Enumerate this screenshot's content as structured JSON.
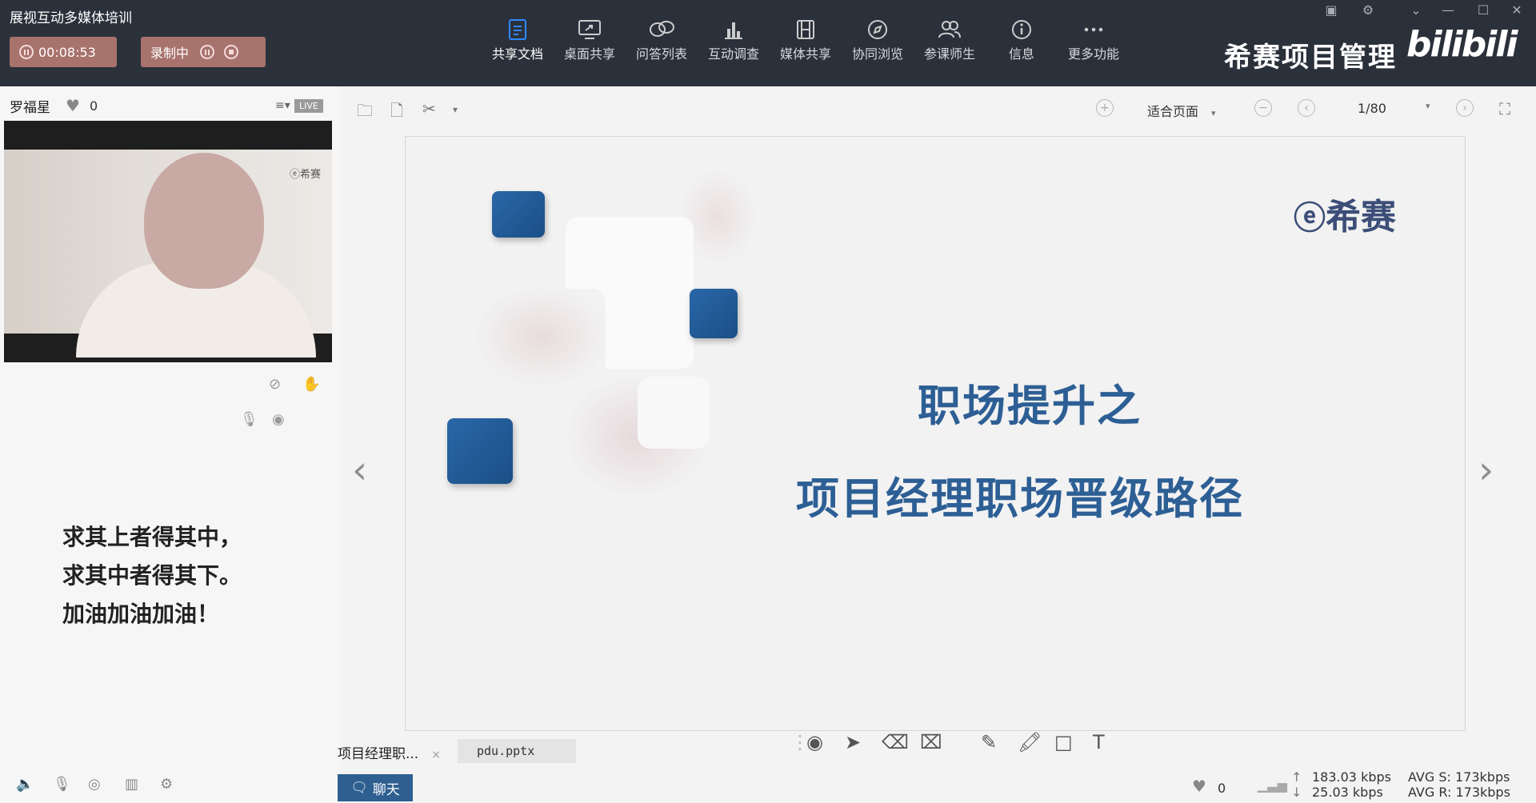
{
  "app": {
    "title": "展视互动多媒体培训"
  },
  "recording": {
    "timer": "00:08:53",
    "status_label": "录制中"
  },
  "toolbar": {
    "items": [
      {
        "label": "共享文档",
        "icon": "document-icon",
        "active": true
      },
      {
        "label": "桌面共享",
        "icon": "desktop-share-icon"
      },
      {
        "label": "问答列表",
        "icon": "qa-bubble-icon"
      },
      {
        "label": "互动调查",
        "icon": "bar-chart-icon"
      },
      {
        "label": "媒体共享",
        "icon": "film-icon"
      },
      {
        "label": "协同浏览",
        "icon": "compass-icon"
      },
      {
        "label": "参课师生",
        "icon": "users-icon"
      },
      {
        "label": "信息",
        "icon": "info-icon"
      },
      {
        "label": "更多功能",
        "icon": "more-dots-icon"
      }
    ]
  },
  "brand": {
    "name": "希赛项目管理",
    "logo_text": "bilibili"
  },
  "speaker": {
    "name": "罗福星",
    "likes": "0",
    "live_badge": "LIVE"
  },
  "video": {
    "watermark": "希赛"
  },
  "motto": {
    "lines": [
      "求其上者得其中，",
      "求其中者得其下。",
      "加油加油加油！"
    ]
  },
  "doc_view": {
    "zoom": "适合页面",
    "page": "1/80"
  },
  "slide": {
    "logo": "希赛",
    "title_line1": "职场提升之",
    "title_line2": "项目经理职场晋级路径"
  },
  "files": {
    "tab1": "项目经理职...",
    "tab1_close": "×",
    "tab2": "pdu.pptx"
  },
  "chat": {
    "label": "聊天"
  },
  "footer": {
    "likes": "0",
    "up_rate": "183.03 kbps",
    "down_rate": "25.03 kbps",
    "avg_s": "AVG S: 173kbps",
    "avg_r": "AVG R: 173kbps"
  },
  "colors": {
    "topbar": "#2b313b",
    "accent_blue": "#2f88ff",
    "slide_title": "#2d5f95",
    "record_pill": "#a8726d",
    "chat_button": "#2e5f90"
  }
}
